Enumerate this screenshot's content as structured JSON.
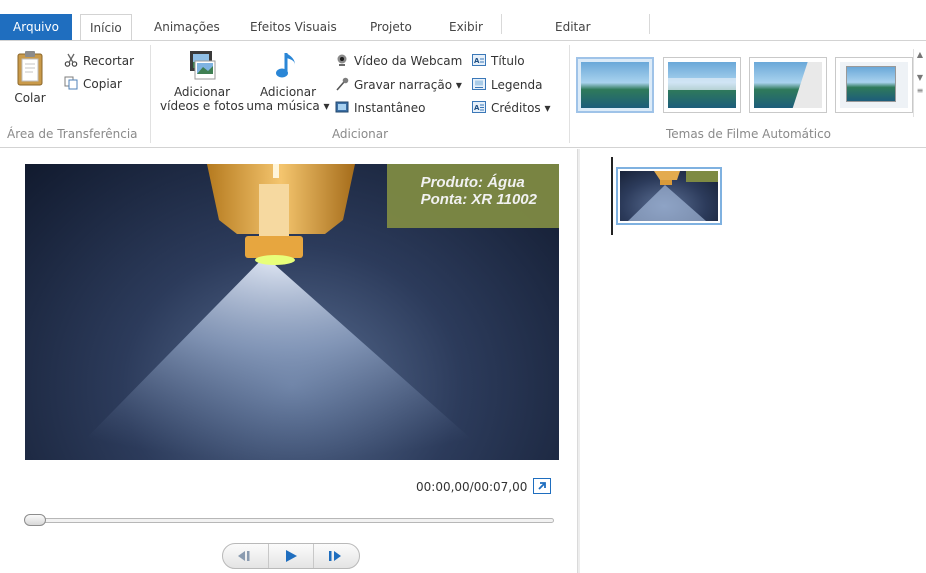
{
  "tabs": {
    "file": "Arquivo",
    "home": "Início",
    "animations": "Animações",
    "visual_effects": "Efeitos Visuais",
    "project": "Projeto",
    "view": "Exibir",
    "edit": "Editar"
  },
  "ribbon": {
    "clipboard": {
      "paste": "Colar",
      "cut": "Recortar",
      "copy": "Copiar",
      "group_label": "Área de Transferência"
    },
    "add": {
      "add_videos_line1": "Adicionar",
      "add_videos_line2": "vídeos e fotos",
      "add_music_line1": "Adicionar",
      "add_music_line2": "uma música ▾",
      "webcam": "Vídeo da Webcam",
      "narration": "Gravar narração ▾",
      "snapshot": "Instantâneo",
      "title": "Título",
      "caption": "Legenda",
      "credits": "Créditos ▾",
      "group_label": "Adicionar"
    },
    "themes": {
      "group_label": "Temas de Filme Automático"
    }
  },
  "preview": {
    "overlay_line1": "Produto: Água",
    "overlay_line2": "Ponta: XR 11002",
    "time": "00:00,00/00:07,00",
    "progress": 0.0
  },
  "colors": {
    "accent": "#1f6ebf",
    "overlay": "#7e8a43",
    "selection": "#dcebf8"
  }
}
